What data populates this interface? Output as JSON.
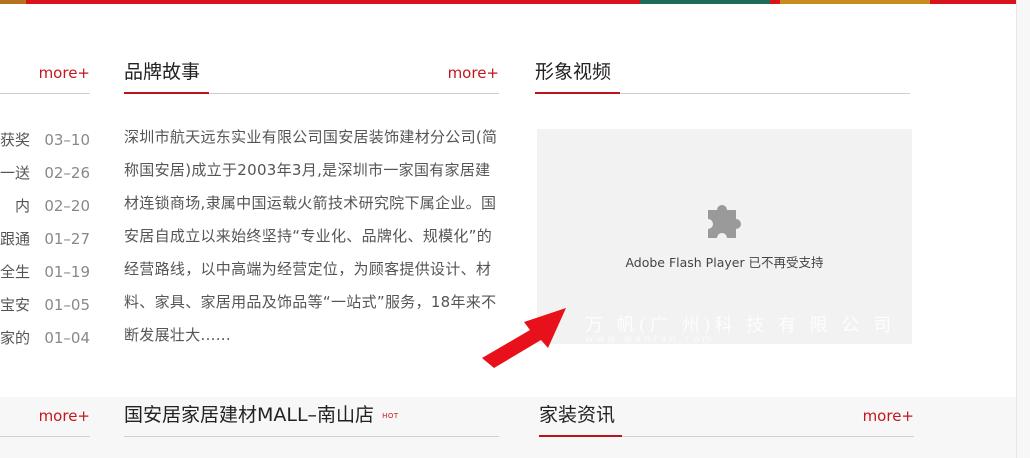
{
  "colors": {
    "accent": "#c4161c",
    "banner": "#d8131b"
  },
  "sections": {
    "news": {
      "more": "more+"
    },
    "brand_story": {
      "title": "品牌故事",
      "more": "more+",
      "paragraph": "深圳市航天远东实业有限公司国安居装饰建材分公司(简称国安居)成立于2003年3月,是深圳市一家国有家居建材连锁商场,隶属中国运载火箭技术研究院下属企业。国安居自成立以来始终坚持“专业化、品牌化、规模化”的经营路线，以中高端为经营定位，为顾客提供设计、材料、家具、家居用品及饰品等“一站式”服务，18年来不断发展壮大......"
    },
    "video": {
      "title": "形象视频",
      "plugin_icon": "puzzle-icon",
      "flash_message": "Adobe Flash Player 已不再受支持",
      "watermark": "万 帆(广 州)科 技 有 限 公 司",
      "watermark_url": "www.wanfan.com"
    },
    "left_bottom": {
      "more": "more+"
    },
    "mall": {
      "title": "国安居家居建材MALL–南山店",
      "badge": "HOT"
    },
    "home_news": {
      "title": "家装资讯",
      "more": "more+"
    }
  },
  "news_items": [
    {
      "title_tail": "获奖",
      "date": "03–10"
    },
    {
      "title_tail": "一送",
      "date": "02–26"
    },
    {
      "title_tail": "内",
      "date": "02–20"
    },
    {
      "title_tail": "跟通",
      "date": "01–27"
    },
    {
      "title_tail": "全生",
      "date": "01–19"
    },
    {
      "title_tail": "宝安",
      "date": "01–05"
    },
    {
      "title_tail": "家的",
      "date": "01–04"
    }
  ]
}
